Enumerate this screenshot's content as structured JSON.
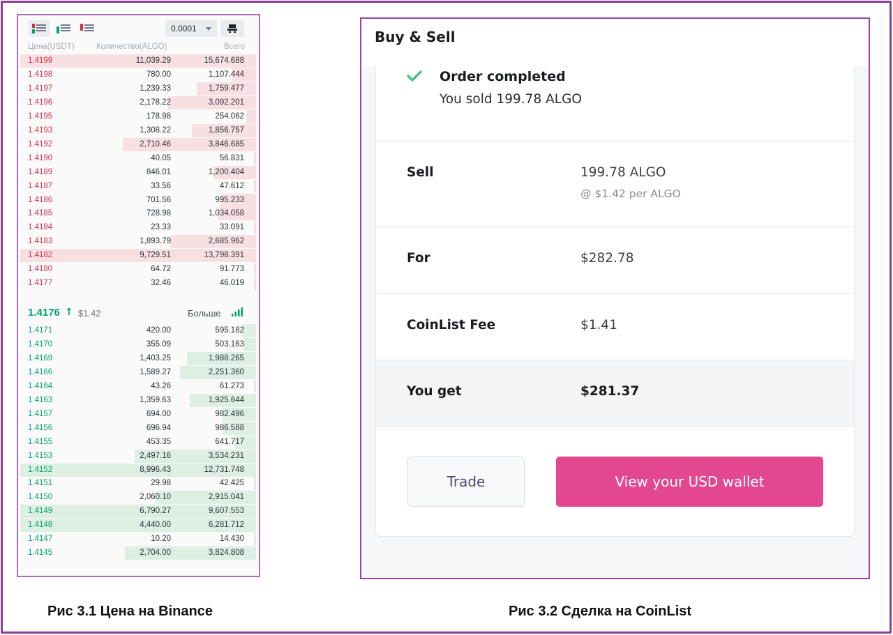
{
  "binance": {
    "tick_size": "0.0001",
    "columns": {
      "price": "Цена(USDT)",
      "amount": "Количество(ALGO)",
      "total": "Всего"
    },
    "asks": [
      {
        "price": "1.4199",
        "amount": "11,039.29",
        "total": "15,674.688",
        "depth": 0.99
      },
      {
        "price": "1.4198",
        "amount": "780.00",
        "total": "1,107.444",
        "depth": 0.1
      },
      {
        "price": "1.4197",
        "amount": "1,239.33",
        "total": "1,759.477",
        "depth": 0.25
      },
      {
        "price": "1.4196",
        "amount": "2,178.22",
        "total": "3,092.201",
        "depth": 0.37
      },
      {
        "price": "1.4195",
        "amount": "178.98",
        "total": "254.062",
        "depth": 0.04
      },
      {
        "price": "1.4193",
        "amount": "1,308.22",
        "total": "1,856.757",
        "depth": 0.27
      },
      {
        "price": "1.4192",
        "amount": "2,710.46",
        "total": "3,846.685",
        "depth": 0.56
      },
      {
        "price": "1.4190",
        "amount": "40.05",
        "total": "56.831",
        "depth": 0.01
      },
      {
        "price": "1.4189",
        "amount": "846.01",
        "total": "1,200.404",
        "depth": 0.18
      },
      {
        "price": "1.4187",
        "amount": "33.56",
        "total": "47.612",
        "depth": 0.01
      },
      {
        "price": "1.4186",
        "amount": "701.56",
        "total": "995.233",
        "depth": 0.15
      },
      {
        "price": "1.4185",
        "amount": "728.98",
        "total": "1,034.058",
        "depth": 0.16
      },
      {
        "price": "1.4184",
        "amount": "23.33",
        "total": "33.091",
        "depth": 0.01
      },
      {
        "price": "1.4183",
        "amount": "1,893.79",
        "total": "2,685.962",
        "depth": 0.36
      },
      {
        "price": "1.4182",
        "amount": "9,729.51",
        "total": "13,798.391",
        "depth": 0.99
      },
      {
        "price": "1.4180",
        "amount": "64.72",
        "total": "91.773",
        "depth": 0.01
      },
      {
        "price": "1.4177",
        "amount": "32.46",
        "total": "46.019",
        "depth": 0.01
      }
    ],
    "mid": {
      "last_price": "1.4176",
      "usd_price": "$1.42",
      "more_label": "Больше"
    },
    "bids": [
      {
        "price": "1.4171",
        "amount": "420.00",
        "total": "595.182",
        "depth": 0.06
      },
      {
        "price": "1.4170",
        "amount": "355.09",
        "total": "503.163",
        "depth": 0.05
      },
      {
        "price": "1.4169",
        "amount": "1,403.25",
        "total": "1,988.265",
        "depth": 0.29
      },
      {
        "price": "1.4166",
        "amount": "1,589.27",
        "total": "2,251.360",
        "depth": 0.32
      },
      {
        "price": "1.4164",
        "amount": "43.26",
        "total": "61.273",
        "depth": 0.01
      },
      {
        "price": "1.4163",
        "amount": "1,359.63",
        "total": "1,925.644",
        "depth": 0.28
      },
      {
        "price": "1.4157",
        "amount": "694.00",
        "total": "982.496",
        "depth": 0.14
      },
      {
        "price": "1.4156",
        "amount": "696.94",
        "total": "986.588",
        "depth": 0.14
      },
      {
        "price": "1.4155",
        "amount": "453.35",
        "total": "641.717",
        "depth": 0.09
      },
      {
        "price": "1.4153",
        "amount": "2,497.16",
        "total": "3,534.231",
        "depth": 0.51
      },
      {
        "price": "1.4152",
        "amount": "8,996.43",
        "total": "12,731.748",
        "depth": 0.99
      },
      {
        "price": "1.4151",
        "amount": "29.98",
        "total": "42.425",
        "depth": 0.01
      },
      {
        "price": "1.4150",
        "amount": "2,060.10",
        "total": "2,915.041",
        "depth": 0.42
      },
      {
        "price": "1.4149",
        "amount": "6,790.27",
        "total": "9,607.553",
        "depth": 0.99
      },
      {
        "price": "1.4148",
        "amount": "4,440.00",
        "total": "6,281.712",
        "depth": 0.99
      },
      {
        "price": "1.4147",
        "amount": "10.20",
        "total": "14.430",
        "depth": 0.01
      },
      {
        "price": "1.4145",
        "amount": "2,704.00",
        "total": "3,824.808",
        "depth": 0.55
      }
    ]
  },
  "coinlist": {
    "title": "Buy & Sell",
    "status_title": "Order completed",
    "status_message": "You sold 199.78 ALGO",
    "rows": {
      "sell": {
        "label": "Sell",
        "value": "199.78 ALGO",
        "sub": "@ $1.42 per ALGO"
      },
      "for": {
        "label": "For",
        "value": "$282.78"
      },
      "fee": {
        "label": "CoinList Fee",
        "value": "$1.41"
      },
      "get": {
        "label": "You get",
        "value": "$281.37"
      }
    },
    "trade_button": "Trade",
    "wallet_button": "View your USD wallet"
  },
  "captions": {
    "left": "Рис 3.1 Цена на Binance",
    "right": "Рис 3.2 Сделка на CoinList"
  },
  "colors": {
    "ask": "#cf304a",
    "bid": "#02a36b",
    "accent": "#e3478f",
    "frame": "#8a3f91"
  }
}
